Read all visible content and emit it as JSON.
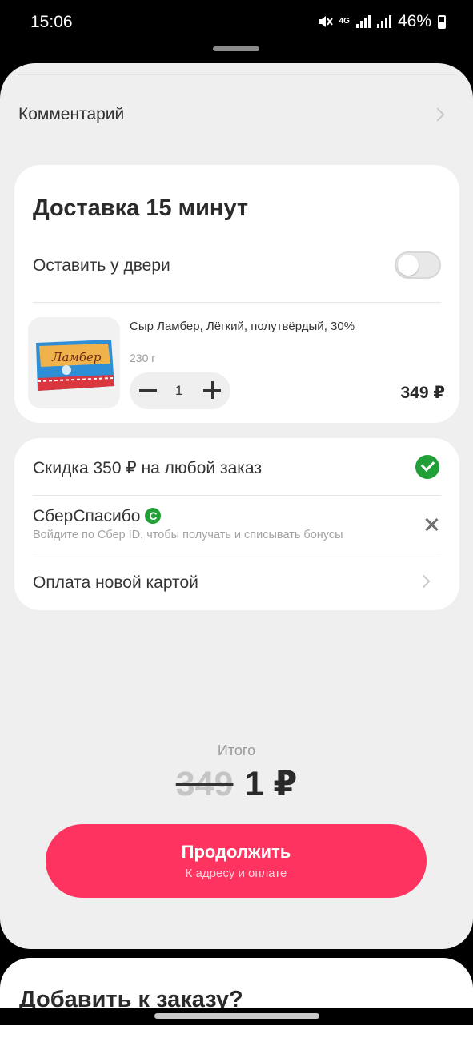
{
  "status_bar": {
    "time": "15:06",
    "network": "4G",
    "battery": "46%",
    "icons": [
      "mute-icon",
      "signal-icon",
      "battery-icon"
    ]
  },
  "comment": {
    "label": "Комментарий"
  },
  "delivery": {
    "title": "Доставка 15 минут",
    "leave_at_door_label": "Оставить у двери",
    "leave_at_door_enabled": false,
    "product": {
      "name": "Сыр Ламбер, Лёгкий, полутвёрдый, 30%",
      "weight": "230 г",
      "quantity": "1",
      "price": "349 ₽",
      "package_text": "Ламбер"
    }
  },
  "options": {
    "discount_label": "Скидка 350 ₽ на любой заказ",
    "sber_title": "СберСпасибо",
    "sber_badge": "С",
    "sber_subtitle": "Войдите по Сбер ID, чтобы получать и списывать бонусы",
    "payment_label": "Оплата новой картой"
  },
  "total": {
    "label": "Итого",
    "old_price": "349",
    "new_price": "1 ₽"
  },
  "cta": {
    "title": "Продолжить",
    "subtitle": "К адресу и оплате"
  },
  "add_to_order": {
    "title": "Добавить к заказу?"
  },
  "colors": {
    "accent": "#ff335f",
    "success": "#21a038",
    "background": "#efefef"
  }
}
